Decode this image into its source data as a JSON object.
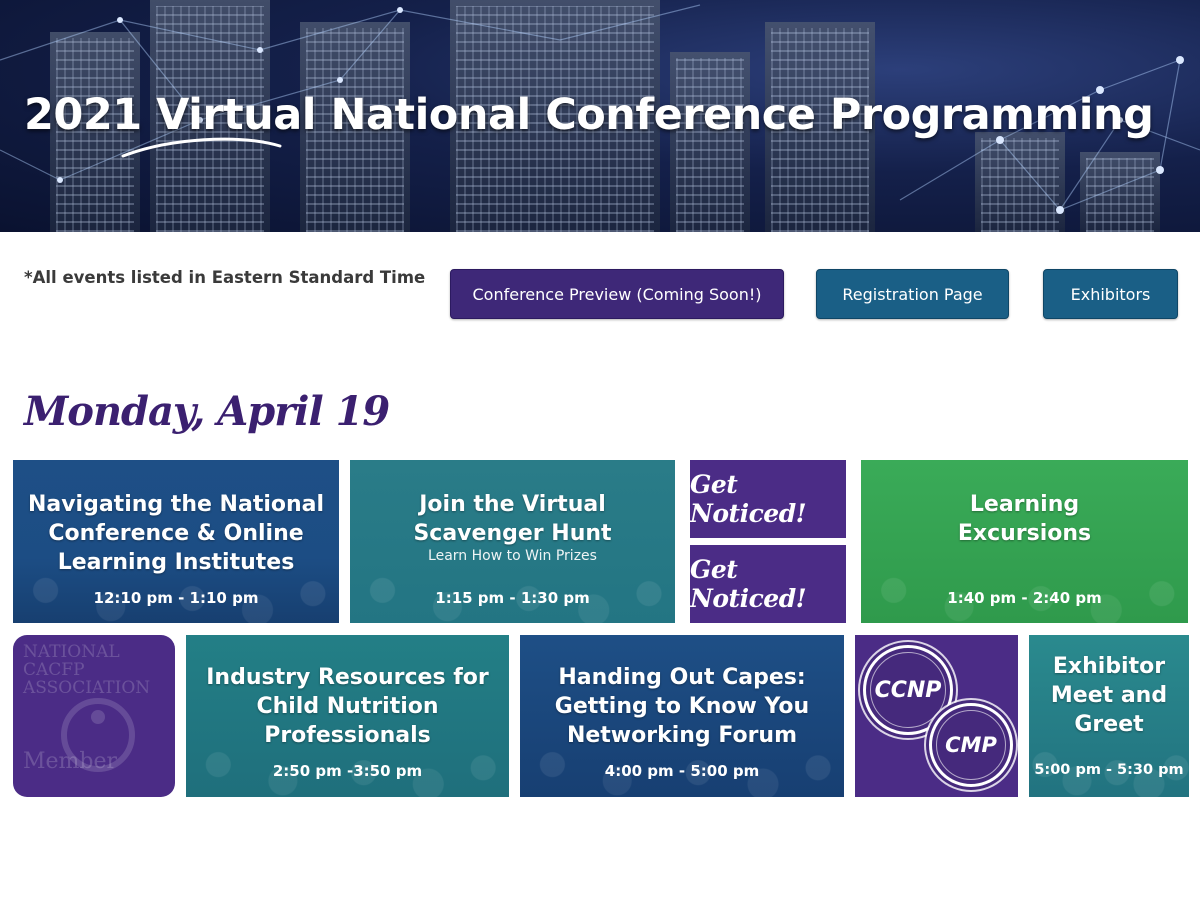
{
  "hero": {
    "title": "2021 Virtual National Conference Programming"
  },
  "toolbar": {
    "timezone_note": "*All events listed in Eastern Standard Time",
    "buttons": {
      "preview": "Conference Preview (Coming Soon!)",
      "registration": "Registration Page",
      "exhibitors": "Exhibitors"
    }
  },
  "day": {
    "heading": "Monday, April 19"
  },
  "tiles": [
    {
      "title_lines": [
        "Navigating the National",
        "Conference & Online",
        "Learning Institutes"
      ],
      "time": "12:10 pm - 1:10 pm"
    },
    {
      "title_lines": [
        "Join the Virtual",
        "Scavenger Hunt"
      ],
      "subtitle": "Learn How to Win Prizes",
      "time": "1:15 pm - 1:30 pm"
    },
    {
      "text": "Get Noticed!"
    },
    {
      "text": "Get Noticed!"
    },
    {
      "title_lines": [
        "Learning",
        "Excursions"
      ],
      "time": "1:40 pm - 2:40 pm"
    },
    {
      "watermark_lines": [
        "NATIONAL",
        "CACFP",
        "ASSOCIATION"
      ],
      "watermark_bottom": "Member"
    },
    {
      "title_lines": [
        "Industry Resources for",
        "Child Nutrition",
        "Professionals"
      ],
      "time": "2:50 pm -3:50 pm"
    },
    {
      "title_lines": [
        "Handing Out Capes:",
        "Getting to Know You",
        "Networking Forum"
      ],
      "time": "4:00 pm - 5:00 pm"
    },
    {
      "badges": [
        "CCNP",
        "CMP"
      ]
    },
    {
      "title_lines": [
        "Exhibitor",
        "Meet and",
        "Greet"
      ],
      "time": "5:00 pm - 5:30 pm"
    }
  ],
  "colors": {
    "brand_purple": "#3e2878",
    "brand_blue": "#1a5f86",
    "tile_green": "#3aab58",
    "tile_teal": "#237583"
  }
}
